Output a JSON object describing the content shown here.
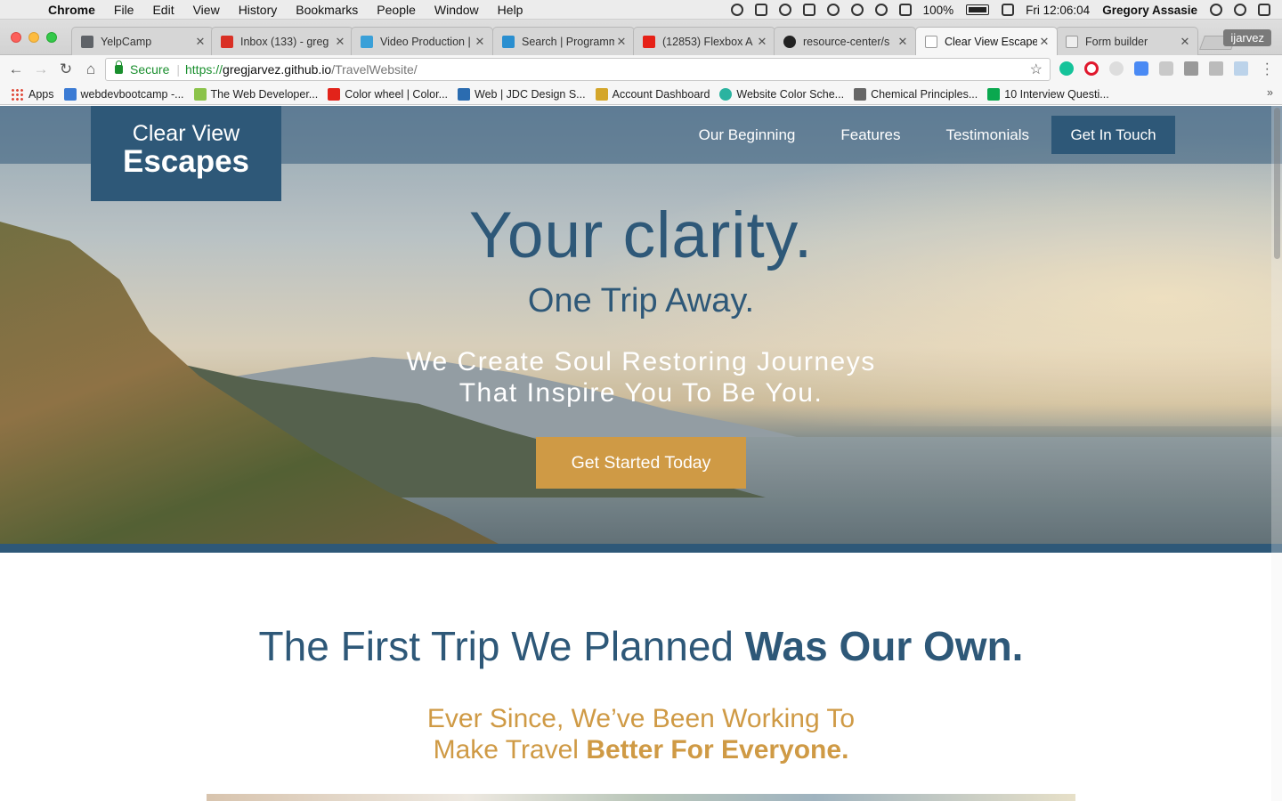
{
  "menubar": {
    "app": "Chrome",
    "items": [
      "File",
      "Edit",
      "View",
      "History",
      "Bookmarks",
      "People",
      "Window",
      "Help"
    ],
    "battery": "100%",
    "clock": "Fri 12:06:04",
    "user": "Gregory Assasie"
  },
  "tabs": [
    {
      "title": "YelpCamp",
      "color": "#5f6368"
    },
    {
      "title": "Inbox (133) - greg",
      "color": "#d93025"
    },
    {
      "title": "Video Production |",
      "color": "#3aa0d8"
    },
    {
      "title": "Search | Programm",
      "color": "#2a8fd0"
    },
    {
      "title": "(12853) Flexbox A",
      "color": "#e62117"
    },
    {
      "title": "resource-center/s",
      "color": "#222222"
    },
    {
      "title": "Clear View Escape",
      "color": "#bbbbbb"
    },
    {
      "title": "Form builder",
      "color": "#bbbbbb"
    }
  ],
  "profile": "ijarvez",
  "omnibox": {
    "secure": "Secure",
    "scheme": "https://",
    "host": "gregjarvez.github.io",
    "path": "/TravelWebsite/"
  },
  "bookmarks": [
    {
      "label": "Apps",
      "color": "#e04a3a"
    },
    {
      "label": "webdevbootcamp -...",
      "color": "#3b7bd4"
    },
    {
      "label": "The Web Developer...",
      "color": "#8bc34a"
    },
    {
      "label": "Color wheel | Color...",
      "color": "#e2231a"
    },
    {
      "label": "Web | JDC Design S...",
      "color": "#2b6cb0"
    },
    {
      "label": "Account Dashboard",
      "color": "#d4a62a"
    },
    {
      "label": "Website Color Sche...",
      "color": "#2bb3a0"
    },
    {
      "label": "Chemical Principles...",
      "color": "#666666"
    },
    {
      "label": "10 Interview Questi...",
      "color": "#0aa84f"
    }
  ],
  "site": {
    "logo_line1": "Clear View",
    "logo_line2": "Escapes",
    "nav": [
      "Our Beginning",
      "Features",
      "Testimonials"
    ],
    "nav_cta": "Get In Touch",
    "hero_title": "Your clarity.",
    "hero_subtitle": "One Trip Away.",
    "hero_tag_line1": "We Create Soul Restoring Journeys",
    "hero_tag_line2": "That Inspire You To Be You.",
    "hero_button": "Get Started Today",
    "section_title_light": "The First Trip We Planned ",
    "section_title_bold": "Was Our Own.",
    "section_sub_line1": "Ever Since, We’ve Been Working To",
    "section_sub_line2_light": "Make Travel ",
    "section_sub_line2_bold": "Better For Everyone."
  },
  "colors": {
    "brand_blue": "#2e5878",
    "brand_gold": "#cf9a45"
  }
}
